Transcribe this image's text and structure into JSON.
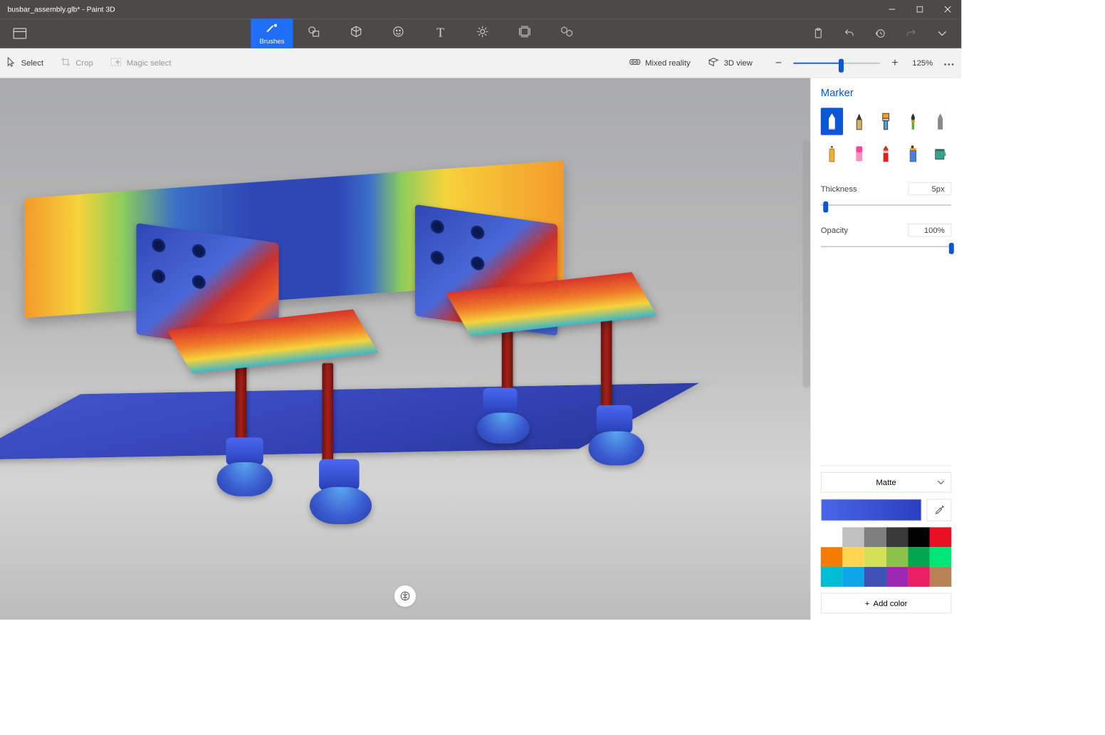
{
  "window": {
    "title": "busbar_assembly.glb* - Paint 3D"
  },
  "ribbon": {
    "tabs": [
      {
        "id": "brushes",
        "label": "Brushes",
        "active": true
      },
      {
        "id": "2d",
        "label": ""
      },
      {
        "id": "3d",
        "label": ""
      },
      {
        "id": "stickers",
        "label": ""
      },
      {
        "id": "text",
        "label": ""
      },
      {
        "id": "effects",
        "label": ""
      },
      {
        "id": "canvas",
        "label": ""
      },
      {
        "id": "library",
        "label": ""
      }
    ]
  },
  "subbar": {
    "select": "Select",
    "crop": "Crop",
    "magic": "Magic select",
    "mixed": "Mixed reality",
    "view3d": "3D view",
    "zoom": "125%"
  },
  "panel": {
    "heading": "Marker",
    "thickness_label": "Thickness",
    "thickness_value": "5px",
    "thickness_pct": 4,
    "opacity_label": "Opacity",
    "opacity_value": "100%",
    "opacity_pct": 100,
    "material": "Matte",
    "addcolor": "Add color",
    "palette": [
      "#ffffff",
      "#c0c0c0",
      "#7f7f7f",
      "#393939",
      "#000000",
      "#e81123",
      "#f57c00",
      "#ffd54f",
      "#d4e157",
      "#8bc34a",
      "#00a650",
      "#00e676",
      "#00bcd4",
      "#0ea5e9",
      "#3f51b5",
      "#9c27b0",
      "#e91e63",
      "#b88254"
    ]
  }
}
